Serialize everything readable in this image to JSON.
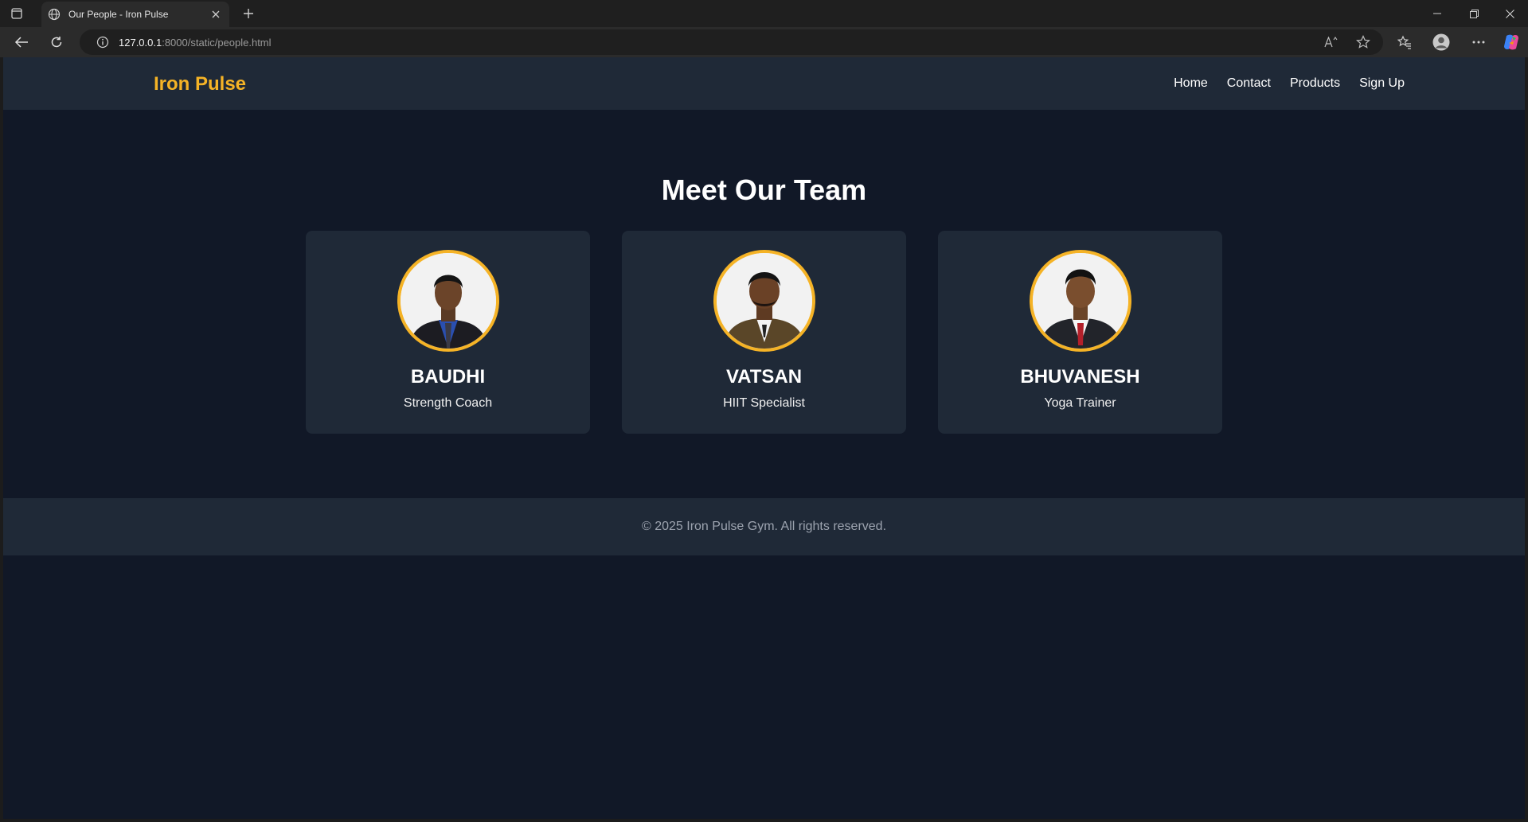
{
  "browser": {
    "tab_title": "Our People - Iron Pulse",
    "url_host": "127.0.0.1",
    "url_path": ":8000/static/people.html"
  },
  "nav": {
    "brand": "Iron Pulse",
    "links": [
      "Home",
      "Contact",
      "Products",
      "Sign Up"
    ]
  },
  "main": {
    "heading": "Meet Our Team",
    "team": [
      {
        "name": "BAUDHI",
        "role": "Strength Coach"
      },
      {
        "name": "VATSAN",
        "role": "HIIT Specialist"
      },
      {
        "name": "BHUVANESH",
        "role": "Yoga Trainer"
      }
    ]
  },
  "footer": {
    "text": "© 2025 Iron Pulse Gym. All rights reserved."
  },
  "colors": {
    "accent": "#f5b326",
    "page_bg": "#111827",
    "panel_bg": "#1f2937"
  }
}
